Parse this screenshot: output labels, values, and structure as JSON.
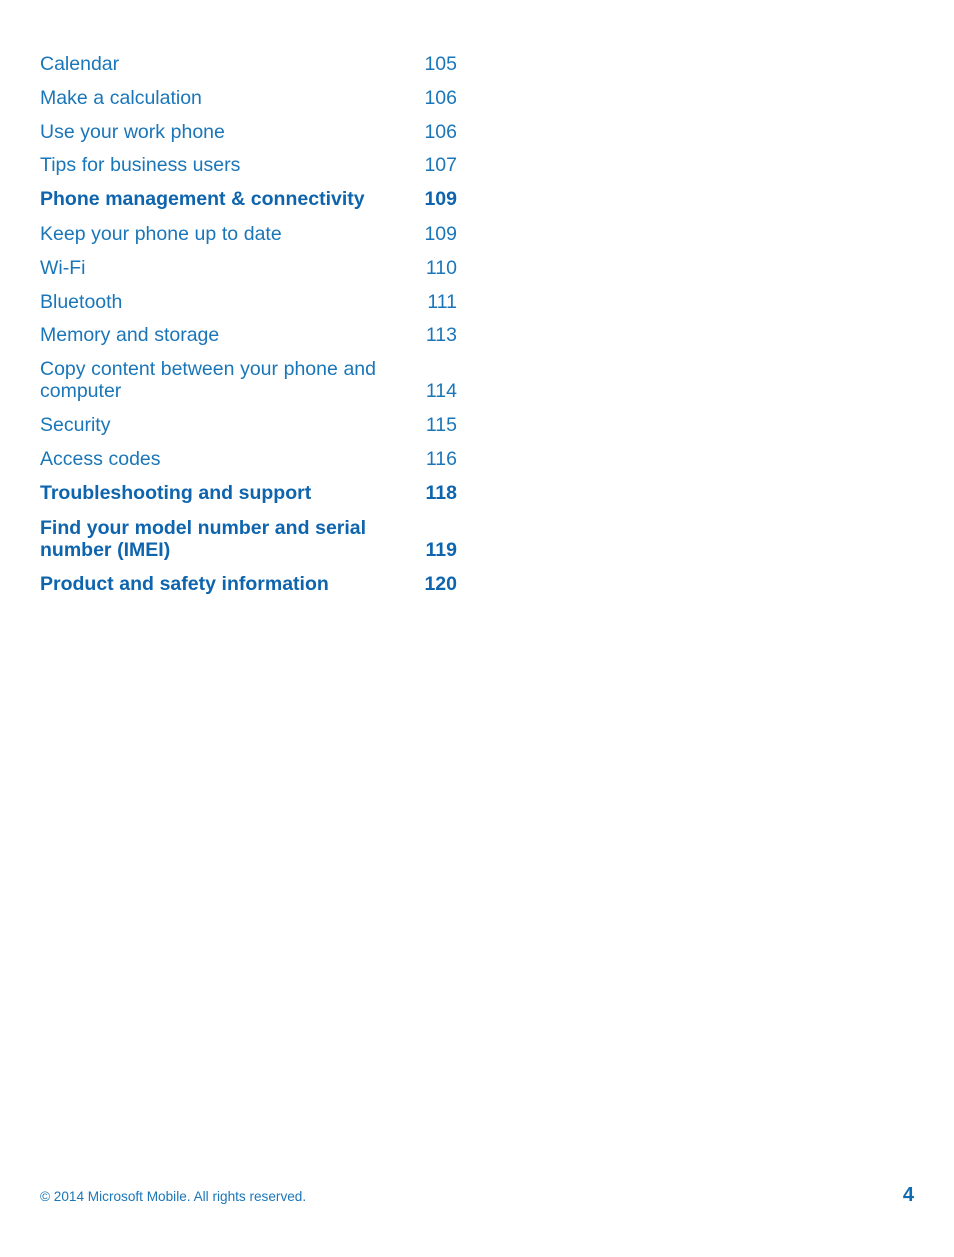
{
  "document": {
    "type": "table-of-contents",
    "page_label": "4"
  },
  "colors": {
    "entry_blue": "#1a76b8",
    "heading_blue": "#0e64ad",
    "folio_blue": "#0e6cb4",
    "background": "#ffffff"
  },
  "toc": {
    "entries": [
      {
        "label": "Calendar",
        "page": "105",
        "bold": false,
        "wrap": false
      },
      {
        "label": "Make a calculation",
        "page": "106",
        "bold": false,
        "wrap": false
      },
      {
        "label": "Use your work phone",
        "page": "106",
        "bold": false,
        "wrap": false
      },
      {
        "label": "Tips for business users",
        "page": "107",
        "bold": false,
        "wrap": false
      },
      {
        "label": "Phone management & connectivity",
        "page": "109",
        "bold": true,
        "wrap": false
      },
      {
        "label": "Keep your phone up to date",
        "page": "109",
        "bold": false,
        "wrap": false
      },
      {
        "label": "Wi-Fi",
        "page": "110",
        "bold": false,
        "wrap": false
      },
      {
        "label": "Bluetooth",
        "page": "111",
        "bold": false,
        "wrap": false
      },
      {
        "label": "Memory and storage",
        "page": "113",
        "bold": false,
        "wrap": false
      },
      {
        "label": "Copy content between your phone and computer",
        "page": "114",
        "bold": false,
        "wrap": true
      },
      {
        "label": "Security",
        "page": "115",
        "bold": false,
        "wrap": false
      },
      {
        "label": "Access codes",
        "page": "116",
        "bold": false,
        "wrap": false
      },
      {
        "label": "Troubleshooting and support",
        "page": "118",
        "bold": true,
        "wrap": false
      },
      {
        "label": "Find your model number and serial number (IMEI)",
        "page": "119",
        "bold": true,
        "wrap": true
      },
      {
        "label": "Product and safety information",
        "page": "120",
        "bold": true,
        "wrap": false
      }
    ]
  },
  "footer": {
    "copyright": "© 2014 Microsoft Mobile. All rights reserved.",
    "folio": "4"
  }
}
